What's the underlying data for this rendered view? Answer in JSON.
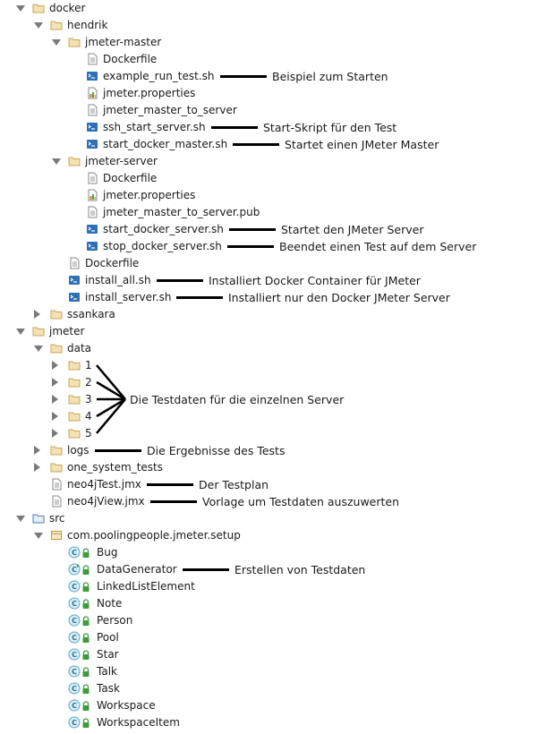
{
  "tree": [
    {
      "label": "docker",
      "type": "folder",
      "depth": 0,
      "twisty": "open",
      "icon": "folder-icon"
    },
    {
      "label": "hendrik",
      "type": "folder",
      "depth": 1,
      "twisty": "open",
      "icon": "folder-icon"
    },
    {
      "label": "jmeter-master",
      "type": "folder",
      "depth": 2,
      "twisty": "open",
      "icon": "folder-icon"
    },
    {
      "label": "Dockerfile",
      "type": "file",
      "depth": 3,
      "icon": "text-file-icon"
    },
    {
      "label": "example_run_test.sh",
      "type": "file",
      "depth": 3,
      "icon": "shell-script-icon"
    },
    {
      "label": "jmeter.properties",
      "type": "file",
      "depth": 3,
      "icon": "properties-file-icon"
    },
    {
      "label": "jmeter_master_to_server",
      "type": "file",
      "depth": 3,
      "icon": "text-file-icon"
    },
    {
      "label": "ssh_start_server.sh",
      "type": "file",
      "depth": 3,
      "icon": "shell-script-icon"
    },
    {
      "label": "start_docker_master.sh",
      "type": "file",
      "depth": 3,
      "icon": "shell-script-icon"
    },
    {
      "label": "jmeter-server",
      "type": "folder",
      "depth": 2,
      "twisty": "open",
      "icon": "folder-icon"
    },
    {
      "label": "Dockerfile",
      "type": "file",
      "depth": 3,
      "icon": "text-file-icon"
    },
    {
      "label": "jmeter.properties",
      "type": "file",
      "depth": 3,
      "icon": "properties-file-icon"
    },
    {
      "label": "jmeter_master_to_server.pub",
      "type": "file",
      "depth": 3,
      "icon": "text-file-icon"
    },
    {
      "label": "start_docker_server.sh",
      "type": "file",
      "depth": 3,
      "icon": "shell-script-icon"
    },
    {
      "label": "stop_docker_server.sh",
      "type": "file",
      "depth": 3,
      "icon": "shell-script-icon"
    },
    {
      "label": "Dockerfile",
      "type": "file",
      "depth": 2,
      "icon": "text-file-icon"
    },
    {
      "label": "install_all.sh",
      "type": "file",
      "depth": 2,
      "icon": "shell-script-icon"
    },
    {
      "label": "install_server.sh",
      "type": "file",
      "depth": 2,
      "icon": "shell-script-icon"
    },
    {
      "label": "ssankara",
      "type": "folder",
      "depth": 1,
      "twisty": "closed",
      "icon": "folder-icon"
    },
    {
      "label": "jmeter",
      "type": "folder",
      "depth": 0,
      "twisty": "open",
      "icon": "folder-icon"
    },
    {
      "label": "data",
      "type": "folder",
      "depth": 1,
      "twisty": "open",
      "icon": "folder-icon"
    },
    {
      "label": "1",
      "type": "folder",
      "depth": 2,
      "twisty": "closed",
      "icon": "folder-icon"
    },
    {
      "label": "2",
      "type": "folder",
      "depth": 2,
      "twisty": "closed",
      "icon": "folder-icon"
    },
    {
      "label": "3",
      "type": "folder",
      "depth": 2,
      "twisty": "closed",
      "icon": "folder-icon"
    },
    {
      "label": "4",
      "type": "folder",
      "depth": 2,
      "twisty": "closed",
      "icon": "folder-icon"
    },
    {
      "label": "5",
      "type": "folder",
      "depth": 2,
      "twisty": "closed",
      "icon": "folder-icon"
    },
    {
      "label": "logs",
      "type": "folder",
      "depth": 1,
      "twisty": "closed",
      "icon": "folder-icon"
    },
    {
      "label": "one_system_tests",
      "type": "folder",
      "depth": 1,
      "twisty": "closed",
      "icon": "folder-icon"
    },
    {
      "label": "neo4jTest.jmx",
      "type": "file",
      "depth": 1,
      "icon": "text-file-icon"
    },
    {
      "label": "neo4jView.jmx",
      "type": "file",
      "depth": 1,
      "icon": "text-file-icon"
    },
    {
      "label": "src",
      "type": "folder",
      "depth": 0,
      "twisty": "open",
      "icon": "source-folder-icon"
    },
    {
      "label": "com.poolingpeople.jmeter.setup",
      "type": "folder",
      "depth": 1,
      "twisty": "open",
      "icon": "package-icon"
    },
    {
      "label": "Bug",
      "type": "class",
      "depth": 2,
      "icon": "java-class-icon"
    },
    {
      "label": "DataGenerator",
      "type": "class",
      "depth": 2,
      "icon": "java-main-class-icon"
    },
    {
      "label": "LinkedListElement",
      "type": "class",
      "depth": 2,
      "icon": "java-class-icon"
    },
    {
      "label": "Note",
      "type": "class",
      "depth": 2,
      "icon": "java-class-icon"
    },
    {
      "label": "Person",
      "type": "class",
      "depth": 2,
      "icon": "java-class-icon"
    },
    {
      "label": "Pool",
      "type": "class",
      "depth": 2,
      "icon": "java-class-icon"
    },
    {
      "label": "Star",
      "type": "class",
      "depth": 2,
      "icon": "java-class-icon"
    },
    {
      "label": "Talk",
      "type": "class",
      "depth": 2,
      "icon": "java-class-icon"
    },
    {
      "label": "Task",
      "type": "class",
      "depth": 2,
      "icon": "java-class-icon"
    },
    {
      "label": "Workspace",
      "type": "class",
      "depth": 2,
      "icon": "java-class-icon"
    },
    {
      "label": "WorkspaceItem",
      "type": "class",
      "depth": 2,
      "icon": "java-class-icon"
    }
  ],
  "annotations": [
    {
      "row": 4,
      "text": "Beispiel zum Starten"
    },
    {
      "row": 7,
      "text": "Start-Skript für den Test"
    },
    {
      "row": 8,
      "text": "Startet einen JMeter Master"
    },
    {
      "row": 13,
      "text": "Startet den JMeter Server"
    },
    {
      "row": 14,
      "text": "Beendet einen Test auf dem Server"
    },
    {
      "row": 16,
      "text": "Installiert Docker Container für JMeter"
    },
    {
      "row": 17,
      "text": "Installiert nur den Docker JMeter Server"
    },
    {
      "row": 23,
      "text": "Die Testdaten für die einzelnen Server"
    },
    {
      "row": 26,
      "text": "Die Ergebnisse des Tests"
    },
    {
      "row": 28,
      "text": "Der Testplan"
    },
    {
      "row": 29,
      "text": "Vorlage um Testdaten auszuwerten"
    },
    {
      "row": 33,
      "text": "Erstellen von Testdaten"
    }
  ],
  "colors": {
    "folder": "#c9a55a",
    "folder_fill": "#f3e2b3",
    "shell": "#2f6fb5",
    "java_class": "#58a9c9",
    "java_class_fill": "#d8eef6",
    "lock": "#3d9b3d",
    "package": "#c69a3a"
  }
}
